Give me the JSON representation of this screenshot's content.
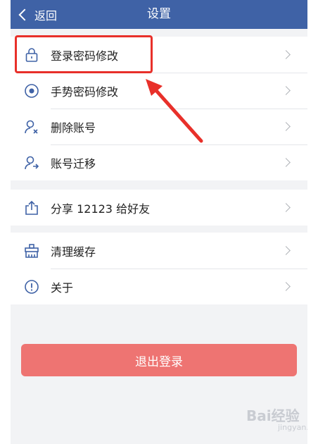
{
  "navbar": {
    "back_label": "返回",
    "title": "设置"
  },
  "groups": [
    {
      "items": [
        {
          "label": "登录密码修改",
          "icon": "lock-icon"
        },
        {
          "label": "手势密码修改",
          "icon": "gesture-icon"
        },
        {
          "label": "删除账号",
          "icon": "user-delete-icon"
        },
        {
          "label": "账号迁移",
          "icon": "user-migrate-icon"
        }
      ]
    },
    {
      "items": [
        {
          "label": "分享 12123 给好友",
          "icon": "share-icon"
        }
      ]
    },
    {
      "items": [
        {
          "label": "清理缓存",
          "icon": "broom-icon"
        },
        {
          "label": "关于",
          "icon": "info-icon"
        }
      ]
    }
  ],
  "logout_label": "退出登录",
  "watermark": {
    "brand": "Bai经验",
    "sub": "jingyan.baidu.com"
  },
  "colors": {
    "navbar": "#3f62a6",
    "logout": "#ee7472",
    "highlight": "#e8302a",
    "icon": "#3f62a6"
  }
}
